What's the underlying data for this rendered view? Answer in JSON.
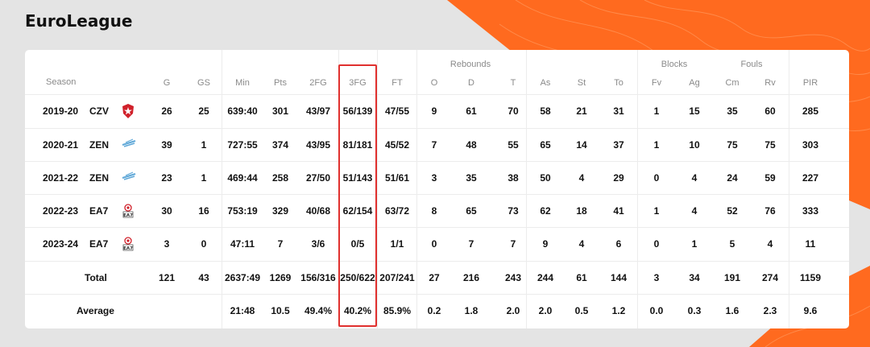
{
  "title": "EuroLeague",
  "header": {
    "season": "Season",
    "groups": {
      "rebounds": "Rebounds",
      "blocks": "Blocks",
      "fouls": "Fouls"
    },
    "columns": [
      "G",
      "GS",
      "Min",
      "Pts",
      "2FG",
      "3FG",
      "FT",
      "O",
      "D",
      "T",
      "As",
      "St",
      "To",
      "Fv",
      "Ag",
      "Cm",
      "Rv",
      "PIR"
    ]
  },
  "rows": [
    {
      "season": "2019-20",
      "team": "CZV",
      "logo_icon": "red-star-logo-icon",
      "stats": [
        "26",
        "25",
        "639:40",
        "301",
        "43/97",
        "56/139",
        "47/55",
        "9",
        "61",
        "70",
        "58",
        "21",
        "31",
        "1",
        "15",
        "35",
        "60",
        "285"
      ]
    },
    {
      "season": "2020-21",
      "team": "ZEN",
      "logo_icon": "zenit-logo-icon",
      "stats": [
        "39",
        "1",
        "727:55",
        "374",
        "43/95",
        "81/181",
        "45/52",
        "7",
        "48",
        "55",
        "65",
        "14",
        "37",
        "1",
        "10",
        "75",
        "75",
        "303"
      ]
    },
    {
      "season": "2021-22",
      "team": "ZEN",
      "logo_icon": "zenit-logo-icon",
      "stats": [
        "23",
        "1",
        "469:44",
        "258",
        "27/50",
        "51/143",
        "51/61",
        "3",
        "35",
        "38",
        "50",
        "4",
        "29",
        "0",
        "4",
        "24",
        "59",
        "227"
      ]
    },
    {
      "season": "2022-23",
      "team": "EA7",
      "logo_icon": "ea7-logo-icon",
      "stats": [
        "30",
        "16",
        "753:19",
        "329",
        "40/68",
        "62/154",
        "63/72",
        "8",
        "65",
        "73",
        "62",
        "18",
        "41",
        "1",
        "4",
        "52",
        "76",
        "333"
      ]
    },
    {
      "season": "2023-24",
      "team": "EA7",
      "logo_icon": "ea7-logo-icon",
      "stats": [
        "3",
        "0",
        "47:11",
        "7",
        "3/6",
        "0/5",
        "1/1",
        "0",
        "7",
        "7",
        "9",
        "4",
        "6",
        "0",
        "1",
        "5",
        "4",
        "11"
      ]
    }
  ],
  "total": {
    "label": "Total",
    "stats": [
      "121",
      "43",
      "2637:49",
      "1269",
      "156/316",
      "250/622",
      "207/241",
      "27",
      "216",
      "243",
      "244",
      "61",
      "144",
      "3",
      "34",
      "191",
      "274",
      "1159"
    ]
  },
  "average": {
    "label": "Average",
    "stats": [
      "",
      "",
      "21:48",
      "10.5",
      "49.4%",
      "40.2%",
      "85.9%",
      "0.2",
      "1.8",
      "2.0",
      "2.0",
      "0.5",
      "1.2",
      "0.0",
      "0.3",
      "1.6",
      "2.3",
      "9.6"
    ]
  },
  "colors": {
    "accent": "#ff6a1f",
    "highlight_border": "#e0302e",
    "card": "#ffffff",
    "background": "#e4e4e4"
  }
}
